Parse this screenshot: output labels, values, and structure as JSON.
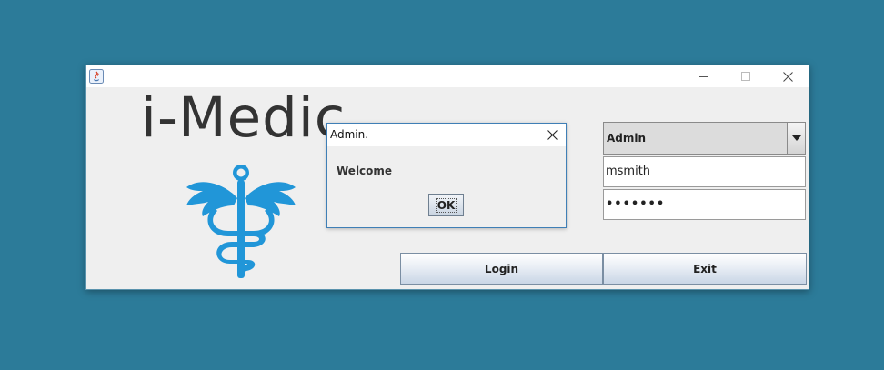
{
  "window": {
    "title": "",
    "controls": [
      "minimize-icon",
      "maximize-icon",
      "close-icon"
    ]
  },
  "logo": {
    "text": "i-Medic",
    "icon": "caduceus-icon",
    "color": "#2196d8"
  },
  "form": {
    "role": {
      "selected": "Admin",
      "icon": "chevron-down-icon"
    },
    "username": {
      "value": "msmith"
    },
    "password": {
      "value": "•••••••"
    }
  },
  "buttons": {
    "login": "Login",
    "exit": "Exit"
  },
  "dialog": {
    "title": "Admin.",
    "message": "Welcome",
    "ok": "OK"
  }
}
